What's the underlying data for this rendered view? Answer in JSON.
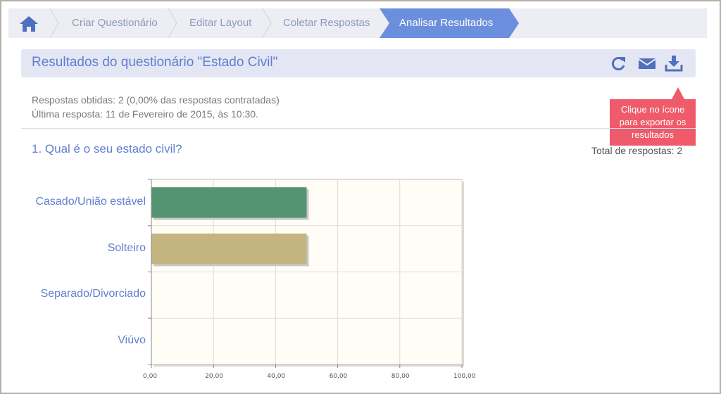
{
  "breadcrumb": {
    "home_icon": "home-icon",
    "steps": [
      "Criar Questionário",
      "Editar Layout",
      "Coletar Respostas"
    ],
    "active": "Analisar Resultados"
  },
  "results": {
    "title": "Resultados do questionário \"Estado Civil\"",
    "icons": [
      "refresh-icon",
      "mail-icon",
      "download-icon"
    ],
    "responses": "Respostas obtidas: 2 (0,00% das respostas contratadas)",
    "last_response": "Última resposta: 11 de Fevereiro de 2015, às 10:30.",
    "tooltip": [
      "Clique no ícone",
      "para exportar os",
      "resultados"
    ]
  },
  "question": {
    "title": "1. Qual é o seu estado civil?",
    "total": "Total de respostas: 2"
  },
  "colors": {
    "accent": "#5f7fcf",
    "active_step": "#6b8edd",
    "bar_1": "#559470",
    "bar_2": "#c4b47f",
    "plot_bg": "#fffdf5",
    "tooltip": "#ef5b6a"
  },
  "chart_data": {
    "type": "bar",
    "orientation": "horizontal",
    "categories": [
      "Casado/União estável",
      "Solteiro",
      "Separado/Divorciado",
      "Viúvo"
    ],
    "values": [
      50,
      50,
      0,
      0
    ],
    "xlim": [
      0,
      100
    ],
    "xticks": [
      "0,00",
      "20,00",
      "40,00",
      "60,00",
      "80,00",
      "100,00"
    ],
    "grid": true
  }
}
